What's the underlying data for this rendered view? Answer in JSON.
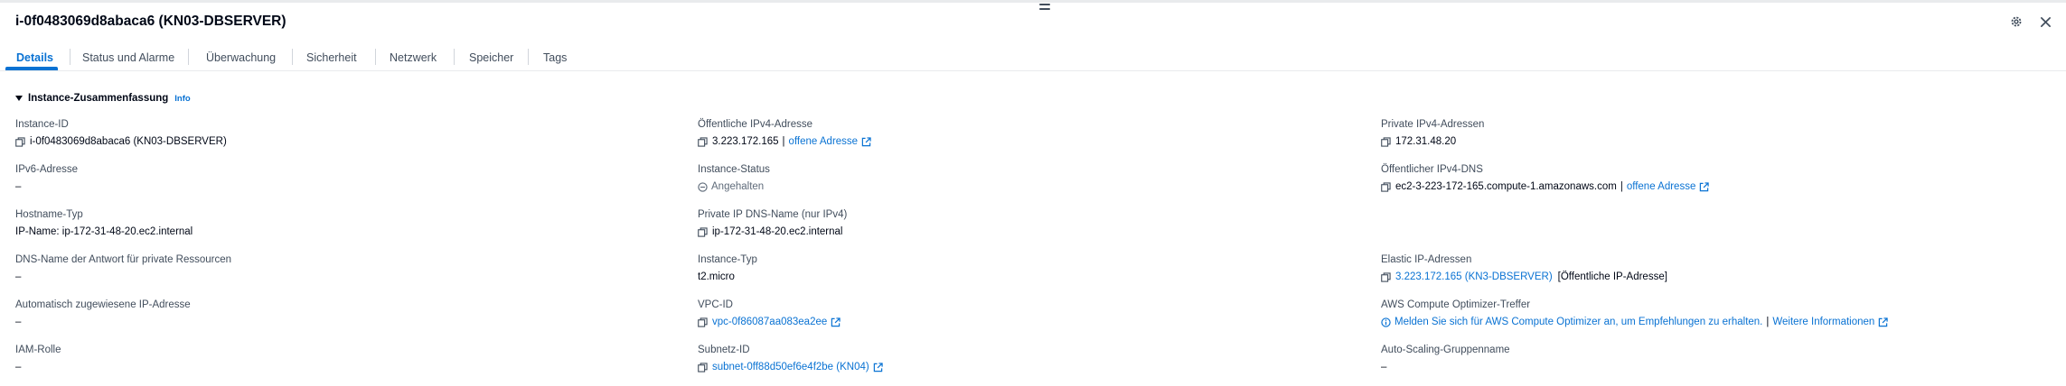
{
  "header": {
    "title": "i-0f0483069d8abaca6 (KN03-DBSERVER)",
    "settings_icon": "gear-icon",
    "close_icon": "close-icon"
  },
  "tabs": [
    {
      "label": "Details",
      "active": true
    },
    {
      "label": "Status und Alarme",
      "active": false
    },
    {
      "label": "Überwachung",
      "active": false
    },
    {
      "label": "Sicherheit",
      "active": false
    },
    {
      "label": "Netzwerk",
      "active": false
    },
    {
      "label": "Speicher",
      "active": false
    },
    {
      "label": "Tags",
      "active": false
    }
  ],
  "section": {
    "title": "Instance-Zusammenfassung",
    "info": "Info"
  },
  "col1": {
    "instance_id": {
      "label": "Instance-ID",
      "value": "i-0f0483069d8abaca6 (KN03-DBSERVER)"
    },
    "ipv6": {
      "label": "IPv6-Adresse",
      "value": "–"
    },
    "hostname_type": {
      "label": "Hostname-Typ",
      "value": "IP-Name: ip-172-31-48-20.ec2.internal"
    },
    "dns_answer": {
      "label": "DNS-Name der Antwort für private Ressourcen",
      "value": "–"
    },
    "auto_ip": {
      "label": "Automatisch zugewiesene IP-Adresse",
      "value": "–"
    },
    "iam_role": {
      "label": "IAM-Rolle",
      "value": "–"
    }
  },
  "col2": {
    "public_ipv4": {
      "label": "Öffentliche IPv4-Adresse",
      "value": "3.223.172.165",
      "link": "offene Adresse"
    },
    "instance_status": {
      "label": "Instance-Status",
      "value": "Angehalten"
    },
    "private_dns": {
      "label": "Private IP DNS-Name (nur IPv4)",
      "value": "ip-172-31-48-20.ec2.internal"
    },
    "instance_type": {
      "label": "Instance-Typ",
      "value": "t2.micro"
    },
    "vpc_id": {
      "label": "VPC-ID",
      "value": "vpc-0f86087aa083ea2ee"
    },
    "subnet_id": {
      "label": "Subnetz-ID",
      "value": "subnet-0ff88d50ef6e4f2be (KN04)"
    }
  },
  "col3": {
    "private_ipv4": {
      "label": "Private IPv4-Adressen",
      "value": "172.31.48.20"
    },
    "public_dns": {
      "label": "Öffentlicher IPv4-DNS",
      "value": "ec2-3-223-172-165.compute-1.amazonaws.com",
      "link": "offene Adresse"
    },
    "elastic_ip": {
      "label": "Elastic IP-Adressen",
      "value": "3.223.172.165 (KN3-DBSERVER)",
      "suffix": "[Öffentliche IP-Adresse]"
    },
    "optimizer": {
      "label": "AWS Compute Optimizer-Treffer",
      "value": "Melden Sie sich für AWS Compute Optimizer an, um Empfehlungen zu erhalten.",
      "link": "Weitere Informationen"
    },
    "asg_name": {
      "label": "Auto-Scaling-Gruppenname",
      "value": "–"
    }
  },
  "colors": {
    "accent": "#0972d3",
    "text": "#000716",
    "label": "#414d5c"
  }
}
